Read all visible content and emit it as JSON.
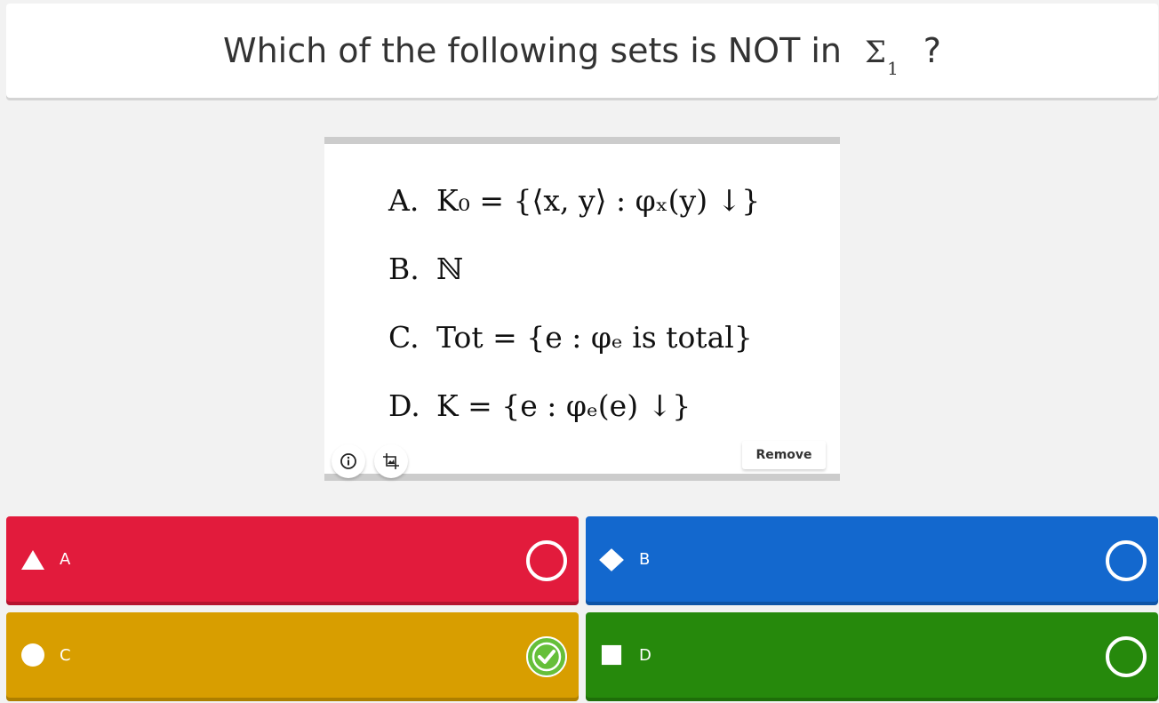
{
  "question": {
    "text": "Which of the following sets is NOT in",
    "symbol": "Σ",
    "subscript": "1",
    "suffix": "?"
  },
  "media": {
    "options": [
      {
        "letter": "A.",
        "formula": "K₀ = {⟨x, y⟩ : φₓ(y) ↓}"
      },
      {
        "letter": "B.",
        "formula": "ℕ"
      },
      {
        "letter": "C.",
        "formula": "Tot = {e : φₑ is total}"
      },
      {
        "letter": "D.",
        "formula": "K = {e : φₑ(e) ↓}"
      }
    ],
    "info_icon": "info-icon",
    "crop_icon": "crop-image-icon",
    "remove_label": "Remove"
  },
  "answers": [
    {
      "label": "A",
      "shape": "triangle-icon",
      "color": "#e21b3c",
      "correct": false
    },
    {
      "label": "B",
      "shape": "diamond-icon",
      "color": "#1368ce",
      "correct": false
    },
    {
      "label": "C",
      "shape": "circle-icon",
      "color": "#d89e00",
      "correct": true
    },
    {
      "label": "D",
      "shape": "square-icon",
      "color": "#26890c",
      "correct": false
    }
  ],
  "colors": {
    "check_green": "#66bf39",
    "background": "#f2f2f2"
  }
}
